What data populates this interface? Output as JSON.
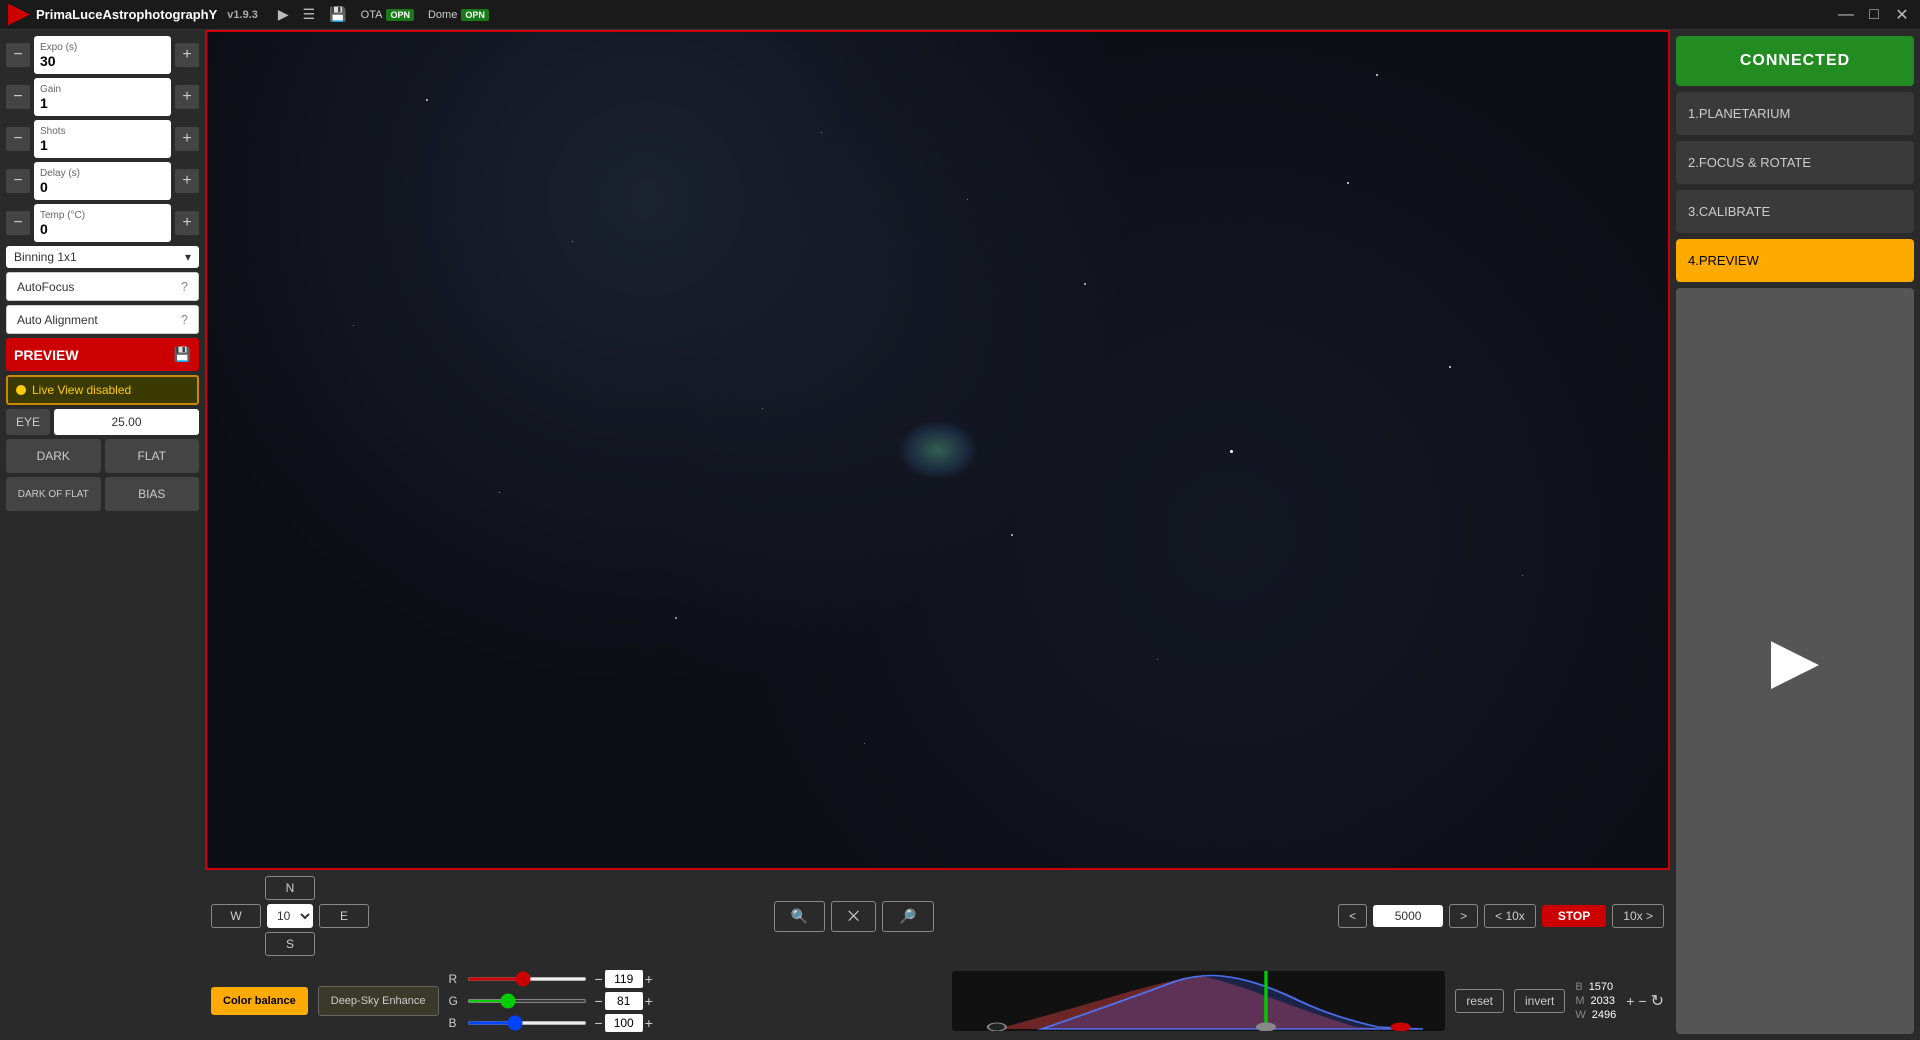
{
  "titlebar": {
    "app_name": "PrimaLuceAstrophotographY",
    "version": "v1.9.3",
    "ota_label": "OTA",
    "ota_badge": "OPN",
    "dome_label": "Dome",
    "dome_badge": "OPN"
  },
  "controls": {
    "expo_label": "Expo (s)",
    "expo_value": "30",
    "gain_label": "Gain",
    "gain_value": "1",
    "shots_label": "Shots",
    "shots_value": "1",
    "delay_label": "Delay (s)",
    "delay_value": "0",
    "temp_label": "Temp (°C)",
    "temp_value": "0",
    "binning_value": "Binning 1x1",
    "autofocus_label": "AutoFocus",
    "auto_alignment_label": "Auto Alignment",
    "preview_label": "PREVIEW",
    "live_view_label": "Live View disabled",
    "eye_label": "EYE",
    "eye_value": "25.00"
  },
  "calibration": {
    "dark_label": "DARK",
    "flat_label": "FLAT",
    "dark_of_flat_label": "DARK OF FLAT",
    "bias_label": "BIAS"
  },
  "navigation": {
    "north": "N",
    "south": "S",
    "east": "E",
    "west": "W",
    "step_value": "10"
  },
  "slew": {
    "less_btn": "<",
    "more_btn": ">",
    "value": "5000",
    "less10_btn": "< 10x",
    "stop_btn": "STOP",
    "more10_btn": "10x >"
  },
  "color": {
    "balance_label": "Color balance",
    "enhance_label": "Deep-Sky Enhance",
    "r_label": "R",
    "r_value": "119",
    "g_label": "G",
    "g_value": "81",
    "b_label": "B",
    "b_value": "100",
    "reset_label": "reset",
    "invert_label": "invert"
  },
  "stats": {
    "b_label": "B",
    "b_value": "1570",
    "m_label": "M",
    "m_value": "2033",
    "w_label": "W",
    "w_value": "2496"
  },
  "right_sidebar": {
    "connected_label": "CONNECTED",
    "menu1": "1.PLANETARIUM",
    "menu2": "2.FOCUS & ROTATE",
    "menu3": "3.CALIBRATE",
    "menu4": "4.PREVIEW"
  },
  "window_controls": {
    "minimize": "—",
    "maximize": "□",
    "close": "✕"
  }
}
